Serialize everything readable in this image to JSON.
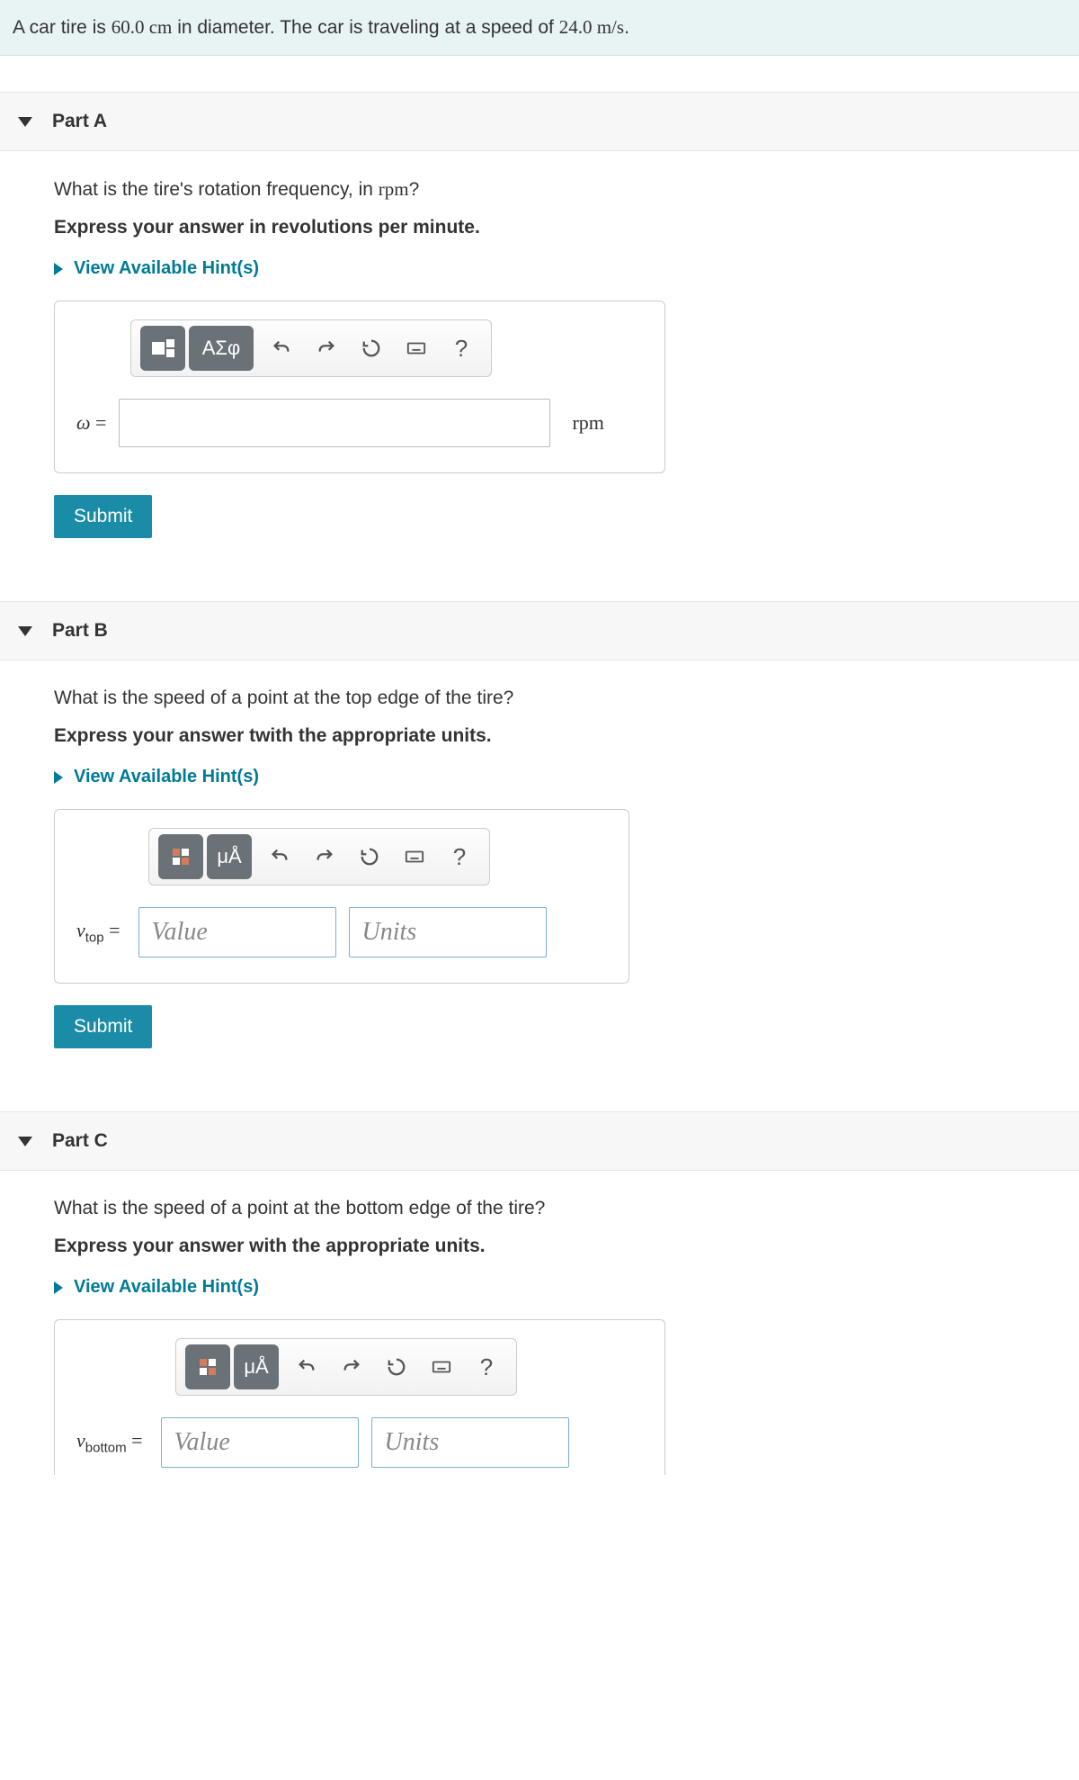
{
  "problem": {
    "text_before_diameter": "A car tire is ",
    "diameter": "60.0 cm",
    "text_mid": " in diameter. The car is traveling at a speed of ",
    "speed": "24.0 m/s",
    "text_after": "."
  },
  "parts": {
    "a": {
      "title": "Part A",
      "question_before": "What is the tire's rotation frequency, in ",
      "question_unit": "rpm",
      "question_after": "?",
      "instruction": "Express your answer in revolutions per minute.",
      "hints_label": "View Available Hint(s)",
      "var_symbol": "ω",
      "equals": " = ",
      "unit": "rpm",
      "submit": "Submit"
    },
    "b": {
      "title": "Part B",
      "question": "What is the speed of a point at the top edge of the tire?",
      "instruction": "Express your answer twith the appropriate units.",
      "hints_label": "View Available Hint(s)",
      "var_symbol": "v",
      "var_sub": "top",
      "equals": " = ",
      "value_placeholder": "Value",
      "units_placeholder": "Units",
      "submit": "Submit"
    },
    "c": {
      "title": "Part C",
      "question": "What is the speed of a point at the bottom edge of the tire?",
      "instruction": "Express your answer with the appropriate units.",
      "hints_label": "View Available Hint(s)",
      "var_symbol": "v",
      "var_sub": "bottom",
      "equals": " = ",
      "value_placeholder": "Value",
      "units_placeholder": "Units"
    }
  },
  "toolbar": {
    "greek": "ΑΣφ",
    "units_btn": "μÅ",
    "help": "?"
  }
}
